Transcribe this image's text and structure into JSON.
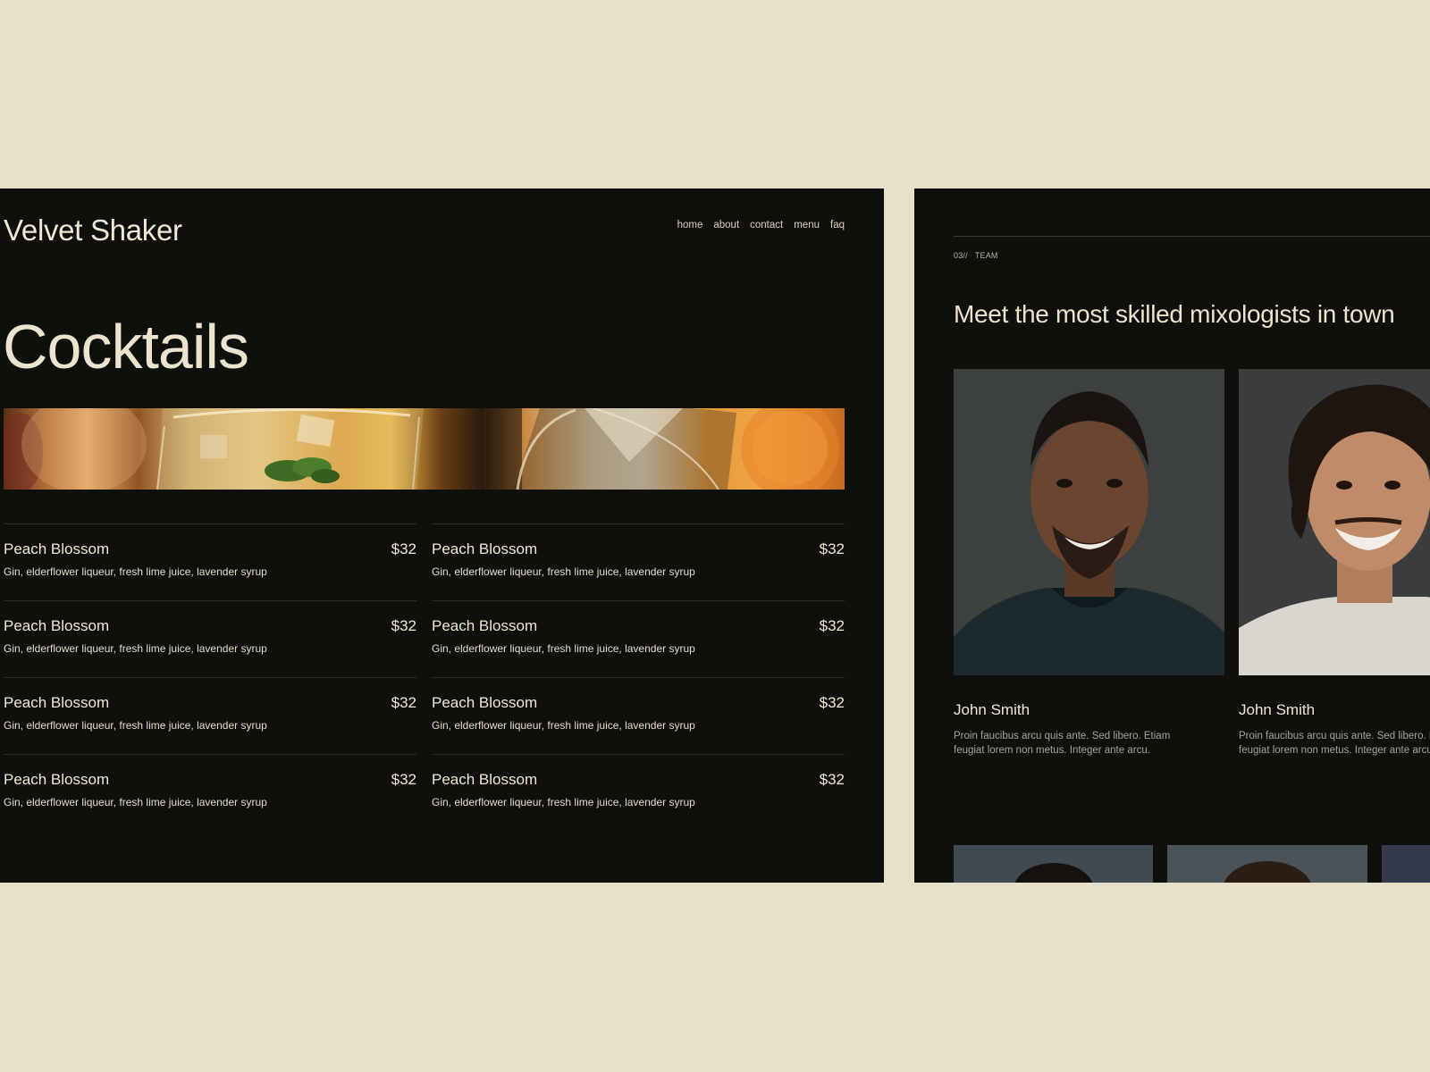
{
  "left": {
    "brand": "Velvet Shaker",
    "nav": [
      "home",
      "about",
      "contact",
      "menu",
      "faq"
    ],
    "title": "Cocktails",
    "menu": [
      {
        "name": "Peach Blossom",
        "price": "$32",
        "desc": "Gin, elderflower liqueur, fresh lime juice, lavender syrup"
      },
      {
        "name": "Peach Blossom",
        "price": "$32",
        "desc": "Gin, elderflower liqueur, fresh lime juice, lavender syrup"
      },
      {
        "name": "Peach Blossom",
        "price": "$32",
        "desc": "Gin, elderflower liqueur, fresh lime juice, lavender syrup"
      },
      {
        "name": "Peach Blossom",
        "price": "$32",
        "desc": "Gin, elderflower liqueur, fresh lime juice, lavender syrup"
      },
      {
        "name": "Peach Blossom",
        "price": "$32",
        "desc": "Gin, elderflower liqueur, fresh lime juice, lavender syrup"
      },
      {
        "name": "Peach Blossom",
        "price": "$32",
        "desc": "Gin, elderflower liqueur, fresh lime juice, lavender syrup"
      },
      {
        "name": "Peach Blossom",
        "price": "$32",
        "desc": "Gin, elderflower liqueur, fresh lime juice, lavender syrup"
      },
      {
        "name": "Peach Blossom",
        "price": "$32",
        "desc": "Gin, elderflower liqueur, fresh lime juice, lavender syrup"
      }
    ]
  },
  "right": {
    "section_number": "03//",
    "section_label": "TEAM",
    "title": "Meet the most skilled mixologists in town",
    "members": [
      {
        "name": "John Smith",
        "bio_line1": "Proin faucibus arcu quis ante. Sed libero. Etiam",
        "bio_line2": "feugiat lorem non metus. Integer ante arcu."
      },
      {
        "name": "John Smith",
        "bio_line1": "Proin faucibus arcu quis ante. Sed libero. Etiam",
        "bio_line2": "feugiat lorem non metus. Integer ante arcu."
      }
    ]
  },
  "colors": {
    "page_bg": "#e8e0c8",
    "panel_bg": "#0f0f0b",
    "text_cream": "#ede4cf",
    "divider": "#2d2c26"
  }
}
